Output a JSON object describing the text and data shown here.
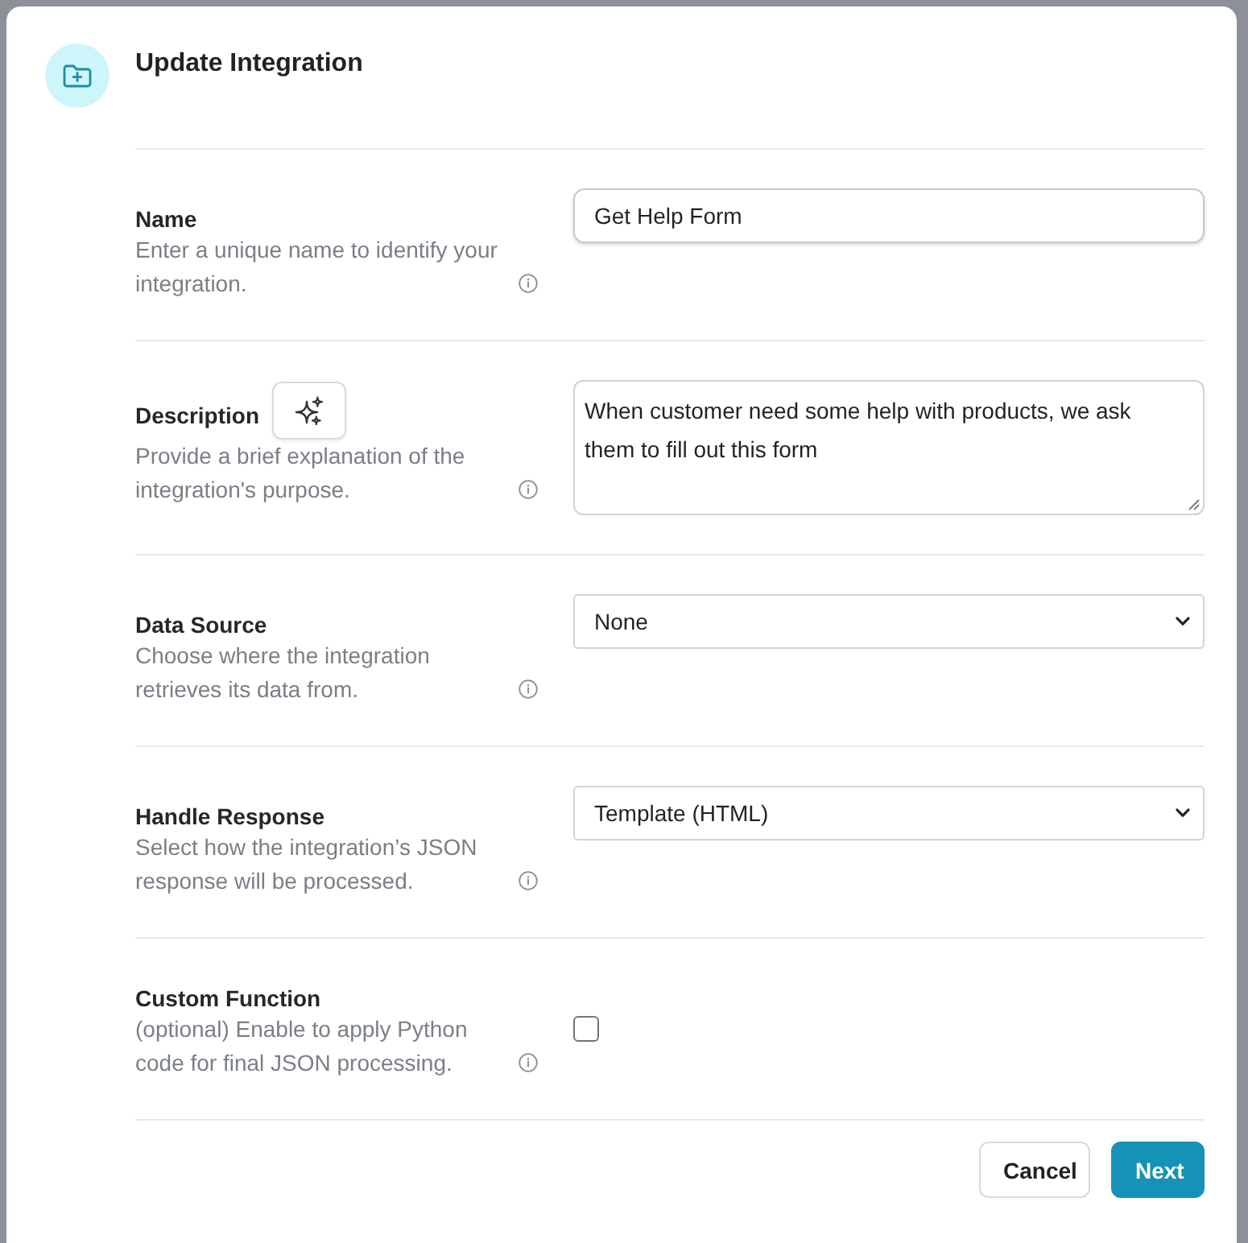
{
  "dialog": {
    "title": "Update Integration"
  },
  "fields": [
    {
      "kind": "text",
      "label": "Name",
      "description": "Enter a unique name to identify your integration.",
      "value": "Get Help Form"
    },
    {
      "kind": "textarea",
      "label": "Description",
      "description": "Provide a brief explanation of the integration's purpose.",
      "value": "When customer need some help with products, we ask them to fill out this form",
      "assist_button": true
    },
    {
      "kind": "select",
      "label": "Data Source",
      "description": "Choose where the integration retrieves its data from.",
      "value": "None"
    },
    {
      "kind": "select",
      "label": "Handle Response",
      "description": "Select how the integration’s JSON response will be processed.",
      "value": "Template (HTML)"
    },
    {
      "kind": "checkbox",
      "label": "Custom Function",
      "description": "(optional) Enable to apply Python code for final JSON processing.",
      "checked": false
    }
  ],
  "buttons": [
    {
      "label": "Cancel",
      "kind": "secondary"
    },
    {
      "label": "Next",
      "kind": "primary"
    }
  ]
}
